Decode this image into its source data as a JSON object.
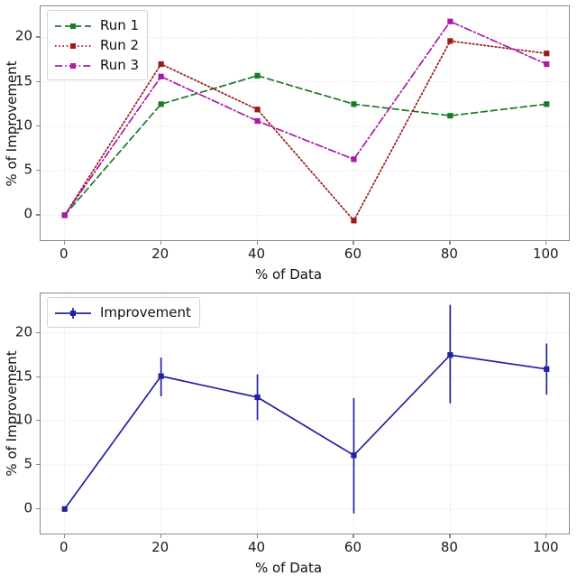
{
  "figure": {
    "background": "#ffffff",
    "panels": 2
  },
  "chart_data": [
    {
      "type": "line",
      "title": "",
      "xlabel": "% of Data",
      "ylabel": "% of Improvement",
      "x": [
        0,
        20,
        40,
        60,
        80,
        100
      ],
      "categories": [
        "0",
        "20",
        "40",
        "60",
        "80",
        "100"
      ],
      "xlim": [
        -5,
        105
      ],
      "ylim": [
        -3.0,
        23.5
      ],
      "xticks": [
        0,
        20,
        40,
        60,
        80,
        100
      ],
      "xtick_labels": [
        "0",
        "20",
        "40",
        "60",
        "80",
        "100"
      ],
      "yticks": [
        0,
        5,
        10,
        15,
        20
      ],
      "ytick_labels": [
        "0",
        "5",
        "10",
        "15",
        "20"
      ],
      "grid": true,
      "legend_position": "upper left",
      "series": [
        {
          "name": "Run 1",
          "color": "#1a7a28",
          "linestyle": "dashed",
          "marker": "square",
          "values": [
            0.0,
            12.5,
            15.7,
            12.5,
            11.2,
            12.5
          ]
        },
        {
          "name": "Run 2",
          "color": "#9e1b1b",
          "linestyle": "dotted",
          "marker": "square",
          "values": [
            0.0,
            17.0,
            11.9,
            -0.6,
            19.6,
            18.2
          ]
        },
        {
          "name": "Run 3",
          "color": "#a81ca8",
          "linestyle": "dashdot",
          "marker": "square",
          "values": [
            0.0,
            15.6,
            10.6,
            6.3,
            21.8,
            17.0
          ]
        }
      ]
    },
    {
      "type": "line",
      "title": "",
      "xlabel": "% of Data",
      "ylabel": "% of Improvement",
      "x": [
        0,
        20,
        40,
        60,
        80,
        100
      ],
      "categories": [
        "0",
        "20",
        "40",
        "60",
        "80",
        "100"
      ],
      "xlim": [
        -5,
        105
      ],
      "ylim": [
        -3.0,
        24.5
      ],
      "xticks": [
        0,
        20,
        40,
        60,
        80,
        100
      ],
      "xtick_labels": [
        "0",
        "20",
        "40",
        "60",
        "80",
        "100"
      ],
      "yticks": [
        0,
        5,
        10,
        15,
        20
      ],
      "ytick_labels": [
        "0",
        "5",
        "10",
        "15",
        "20"
      ],
      "grid": true,
      "legend_position": "upper left",
      "series": [
        {
          "name": "Improvement",
          "color": "#2222a0",
          "linestyle": "solid",
          "marker": "square",
          "values": [
            0.0,
            15.1,
            12.7,
            6.1,
            17.5,
            15.9
          ],
          "error_low": [
            0.0,
            12.8,
            10.1,
            -0.5,
            12.0,
            13.0
          ],
          "error_high": [
            0.0,
            17.2,
            15.3,
            12.6,
            23.2,
            18.8
          ]
        }
      ]
    }
  ]
}
